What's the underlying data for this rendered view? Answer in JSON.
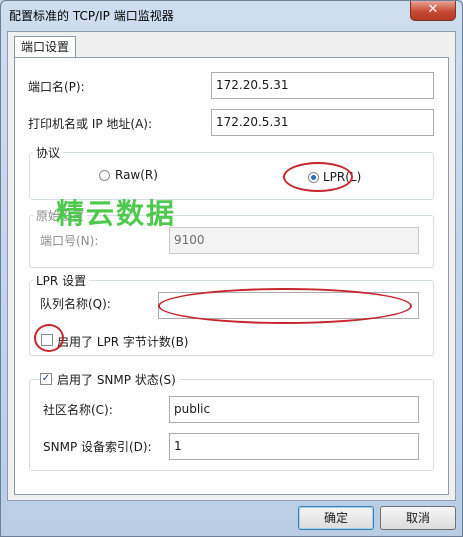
{
  "window": {
    "title": "配置标准的 TCP/IP 端口监视器",
    "close_glyph": "✕"
  },
  "tabs": [
    {
      "label": "端口设置"
    }
  ],
  "fields": {
    "port_name": {
      "label": "端口名(P):",
      "value": "172.20.5.31"
    },
    "printer_address": {
      "label": "打印机名或 IP 地址(A):",
      "value": "172.20.5.31"
    }
  },
  "protocol": {
    "title": "协议",
    "options": [
      {
        "label": "Raw(R)",
        "checked": false
      },
      {
        "label": "LPR(L)",
        "checked": true
      }
    ]
  },
  "raw_settings": {
    "title": "原始设置",
    "port_number": {
      "label": "端口号(N):",
      "value": "9100"
    }
  },
  "lpr_settings": {
    "title": "LPR 设置",
    "queue_name": {
      "label": "队列名称(Q):",
      "value": ""
    },
    "byte_count": {
      "label": "启用了 LPR 字节计数(B)",
      "checked": false
    }
  },
  "snmp": {
    "enabled_label": "启用了 SNMP 状态(S)",
    "enabled": true,
    "community": {
      "label": "社区名称(C):",
      "value": "public"
    },
    "device_index": {
      "label": "SNMP 设备索引(D):",
      "value": "1"
    }
  },
  "buttons": {
    "ok": "确定",
    "cancel": "取消"
  },
  "watermark": {
    "text": "精云数据"
  },
  "colors": {
    "annotation": "#c6262e",
    "watermark": "#4ec94e",
    "accent": "#2a6ac7"
  }
}
